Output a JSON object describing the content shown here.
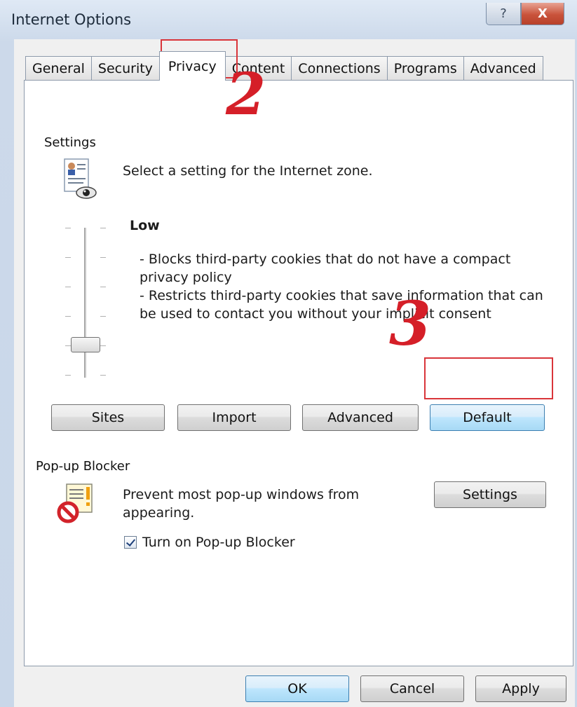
{
  "window": {
    "title": "Internet Options",
    "help_label": "?",
    "close_label": "X"
  },
  "tabs": [
    {
      "label": "General"
    },
    {
      "label": "Security"
    },
    {
      "label": "Privacy"
    },
    {
      "label": "Content"
    },
    {
      "label": "Connections"
    },
    {
      "label": "Programs"
    },
    {
      "label": "Advanced"
    }
  ],
  "active_tab": "Privacy",
  "settings": {
    "group_label": "Settings",
    "zone_text": "Select a setting for the Internet zone.",
    "level_title": "Low",
    "level_desc_1": "- Blocks third-party cookies that do not have a compact privacy policy",
    "level_desc_2": "- Restricts third-party cookies that save information that can be used to contact you without your implicit consent",
    "buttons": {
      "sites": "Sites",
      "import": "Import",
      "advanced": "Advanced",
      "default": "Default"
    }
  },
  "popup_blocker": {
    "group_label": "Pop-up Blocker",
    "description": "Prevent most pop-up windows from appearing.",
    "settings_button": "Settings",
    "checkbox_label": "Turn on Pop-up Blocker",
    "checkbox_checked": true
  },
  "footer": {
    "ok": "OK",
    "cancel": "Cancel",
    "apply": "Apply"
  },
  "annotations": {
    "step_privacy": "2",
    "step_default": "3",
    "highlight_color": "#d9353a"
  }
}
